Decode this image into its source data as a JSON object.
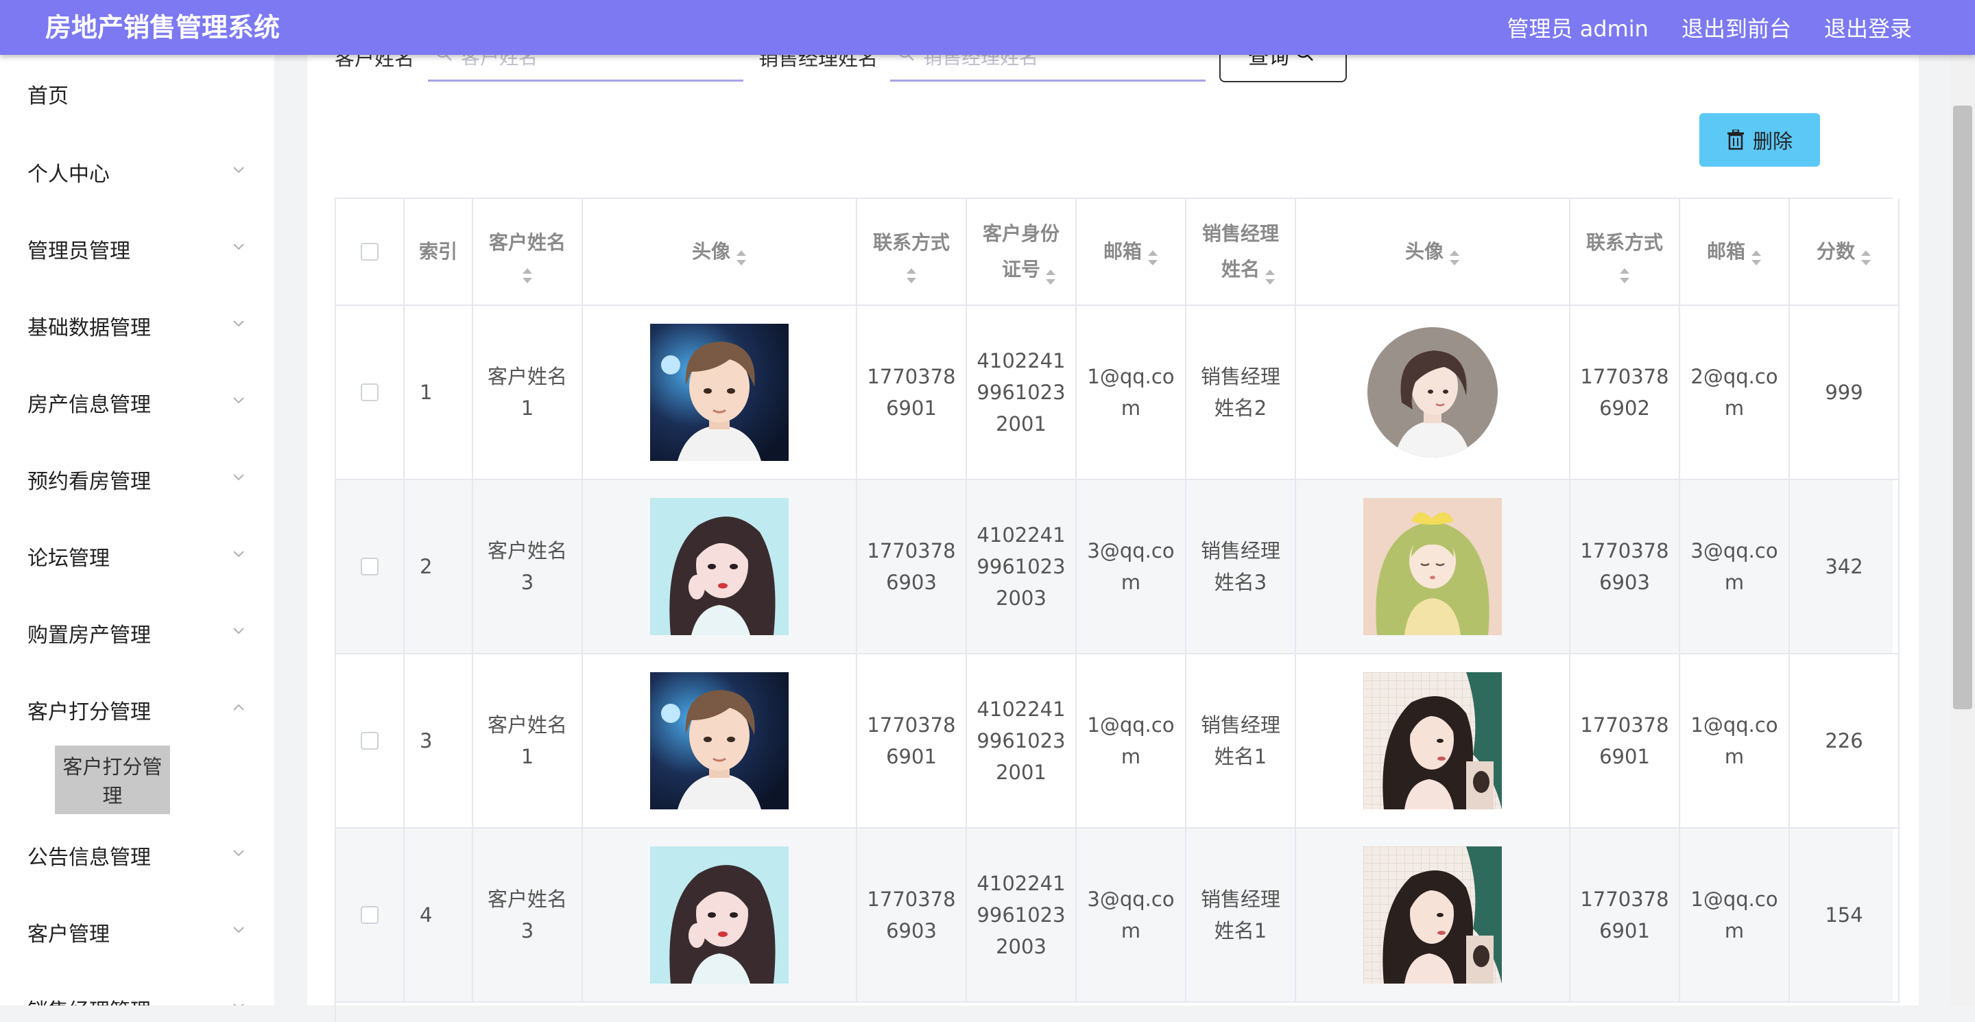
{
  "header": {
    "title": "房地产销售管理系统",
    "links": [
      "管理员 admin",
      "退出到前台",
      "退出登录"
    ]
  },
  "sidebar": {
    "items": [
      {
        "label": "首页",
        "chevron": "none"
      },
      {
        "label": "个人中心",
        "chevron": "down"
      },
      {
        "label": "管理员管理",
        "chevron": "down"
      },
      {
        "label": "基础数据管理",
        "chevron": "down"
      },
      {
        "label": "房产信息管理",
        "chevron": "down"
      },
      {
        "label": "预约看房管理",
        "chevron": "down"
      },
      {
        "label": "论坛管理",
        "chevron": "down"
      },
      {
        "label": "购置房产管理",
        "chevron": "down"
      },
      {
        "label": "客户打分管理",
        "chevron": "up"
      },
      {
        "label": "公告信息管理",
        "chevron": "down"
      },
      {
        "label": "客户管理",
        "chevron": "down"
      },
      {
        "label": "销售经理管理",
        "chevron": "down"
      }
    ],
    "submenu": {
      "label": "客户打分管理",
      "active": true
    }
  },
  "search": {
    "customer_label": "客户姓名",
    "customer_placeholder": "客户姓名",
    "manager_label": "销售经理姓名",
    "manager_placeholder": "销售经理姓名",
    "query_label": "查询"
  },
  "toolbar": {
    "delete_label": "删除"
  },
  "table": {
    "columns": [
      {
        "label": "",
        "sortable": false
      },
      {
        "label": "索引",
        "sortable": false
      },
      {
        "label": "客户姓名",
        "sortable": true
      },
      {
        "label": "头像",
        "sortable": true
      },
      {
        "label": "联系方式",
        "sortable": true
      },
      {
        "label": "客户身份证号",
        "sortable": true
      },
      {
        "label": "邮箱",
        "sortable": true
      },
      {
        "label": "销售经理姓名",
        "sortable": true
      },
      {
        "label": "头像",
        "sortable": true
      },
      {
        "label": "联系方式",
        "sortable": true
      },
      {
        "label": "邮箱",
        "sortable": true
      },
      {
        "label": "分数",
        "sortable": true
      }
    ],
    "rows": [
      {
        "index": "1",
        "customer_name": "客户姓名1",
        "customer_avatar": "boy-avatar",
        "customer_phone": "17703786901",
        "id_number": "410224199610232001",
        "customer_email": "1@qq.com",
        "manager_name": "销售经理姓名2",
        "manager_avatar": "short-hair-girl-avatar",
        "manager_phone": "17703786902",
        "manager_email": "2@qq.com",
        "score": "999"
      },
      {
        "index": "2",
        "customer_name": "客户姓名3",
        "customer_avatar": "long-hair-girl-avatar",
        "customer_phone": "17703786903",
        "id_number": "410224199610232003",
        "customer_email": "3@qq.com",
        "manager_name": "销售经理姓名3",
        "manager_avatar": "green-hair-girl-avatar",
        "manager_phone": "17703786903",
        "manager_email": "3@qq.com",
        "score": "342"
      },
      {
        "index": "3",
        "customer_name": "客户姓名1",
        "customer_avatar": "boy-avatar",
        "customer_phone": "17703786901",
        "id_number": "410224199610232001",
        "customer_email": "1@qq.com",
        "manager_name": "销售经理姓名1",
        "manager_avatar": "dark-hair-girl-avatar",
        "manager_phone": "17703786901",
        "manager_email": "1@qq.com",
        "score": "226"
      },
      {
        "index": "4",
        "customer_name": "客户姓名3",
        "customer_avatar": "long-hair-girl-avatar",
        "customer_phone": "17703786903",
        "id_number": "410224199610232003",
        "customer_email": "3@qq.com",
        "manager_name": "销售经理姓名1",
        "manager_avatar": "dark-hair-girl-avatar",
        "manager_phone": "17703786901",
        "manager_email": "1@qq.com",
        "score": "154"
      }
    ]
  },
  "colors": {
    "header_bg": "#7c79f2",
    "delete_button": "#5cc8f6",
    "active_submenu": "#c8c8c8",
    "row_alt": "#f5f6f8"
  }
}
